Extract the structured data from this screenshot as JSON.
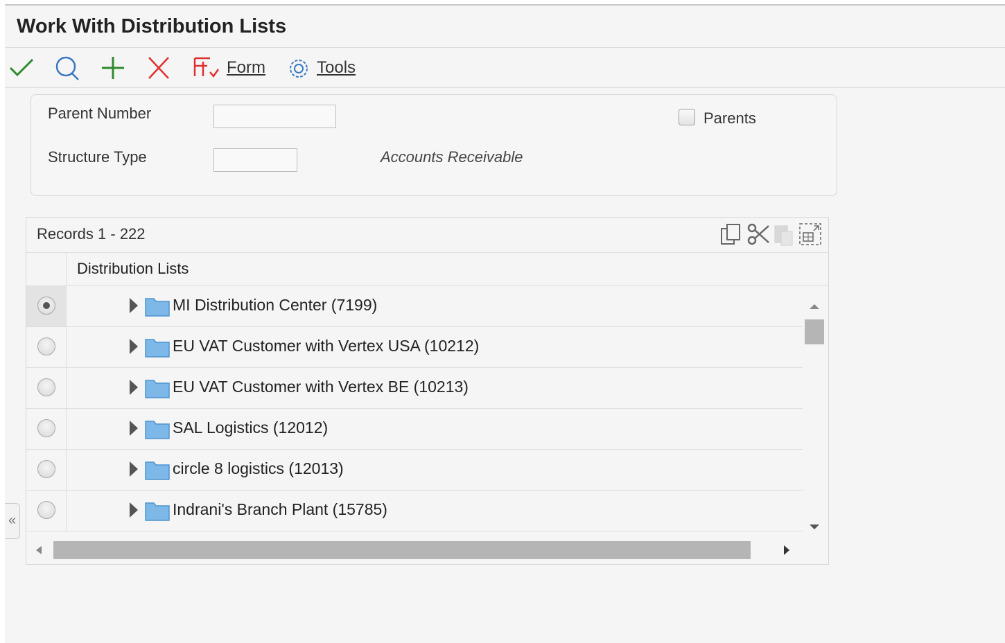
{
  "title": "Work With Distribution Lists",
  "toolbar": {
    "form_label": "Form",
    "tools_label": "Tools"
  },
  "filters": {
    "parent_number": {
      "label": "Parent Number",
      "value": ""
    },
    "structure_type": {
      "label": "Structure Type",
      "value": "",
      "description": "Accounts Receivable"
    },
    "parents_checkbox": {
      "label": "Parents",
      "checked": false
    }
  },
  "grid": {
    "records_label": "Records  1 - 222",
    "column_header": "Distribution Lists",
    "rows": [
      {
        "label": "MI Distribution Center (7199)",
        "selected": true
      },
      {
        "label": "EU VAT Customer with Vertex USA (10212)",
        "selected": false
      },
      {
        "label": "EU VAT Customer with Vertex BE (10213)",
        "selected": false
      },
      {
        "label": "SAL Logistics (12012)",
        "selected": false
      },
      {
        "label": "circle 8 logistics (12013)",
        "selected": false
      },
      {
        "label": "Indrani's Branch Plant (15785)",
        "selected": false
      }
    ]
  },
  "colors": {
    "check_green": "#2e8b2e",
    "plus_green": "#2e8b2e",
    "delete_red": "#e03030",
    "form_red": "#e03030",
    "tools_blue": "#3a78c2",
    "search_blue": "#3a78c2",
    "folder_blue": "#7db8e8"
  },
  "icons": {
    "ok": "checkmark-icon",
    "find": "search-icon",
    "add": "plus-icon",
    "delete": "delete-x-icon",
    "form": "form-menu-icon",
    "tools": "gear-icon",
    "copy": "copy-icon",
    "cut": "cut-icon",
    "paste": "paste-icon",
    "expand": "expand-grid-icon",
    "collapse_side": "double-chevron-left-icon"
  }
}
